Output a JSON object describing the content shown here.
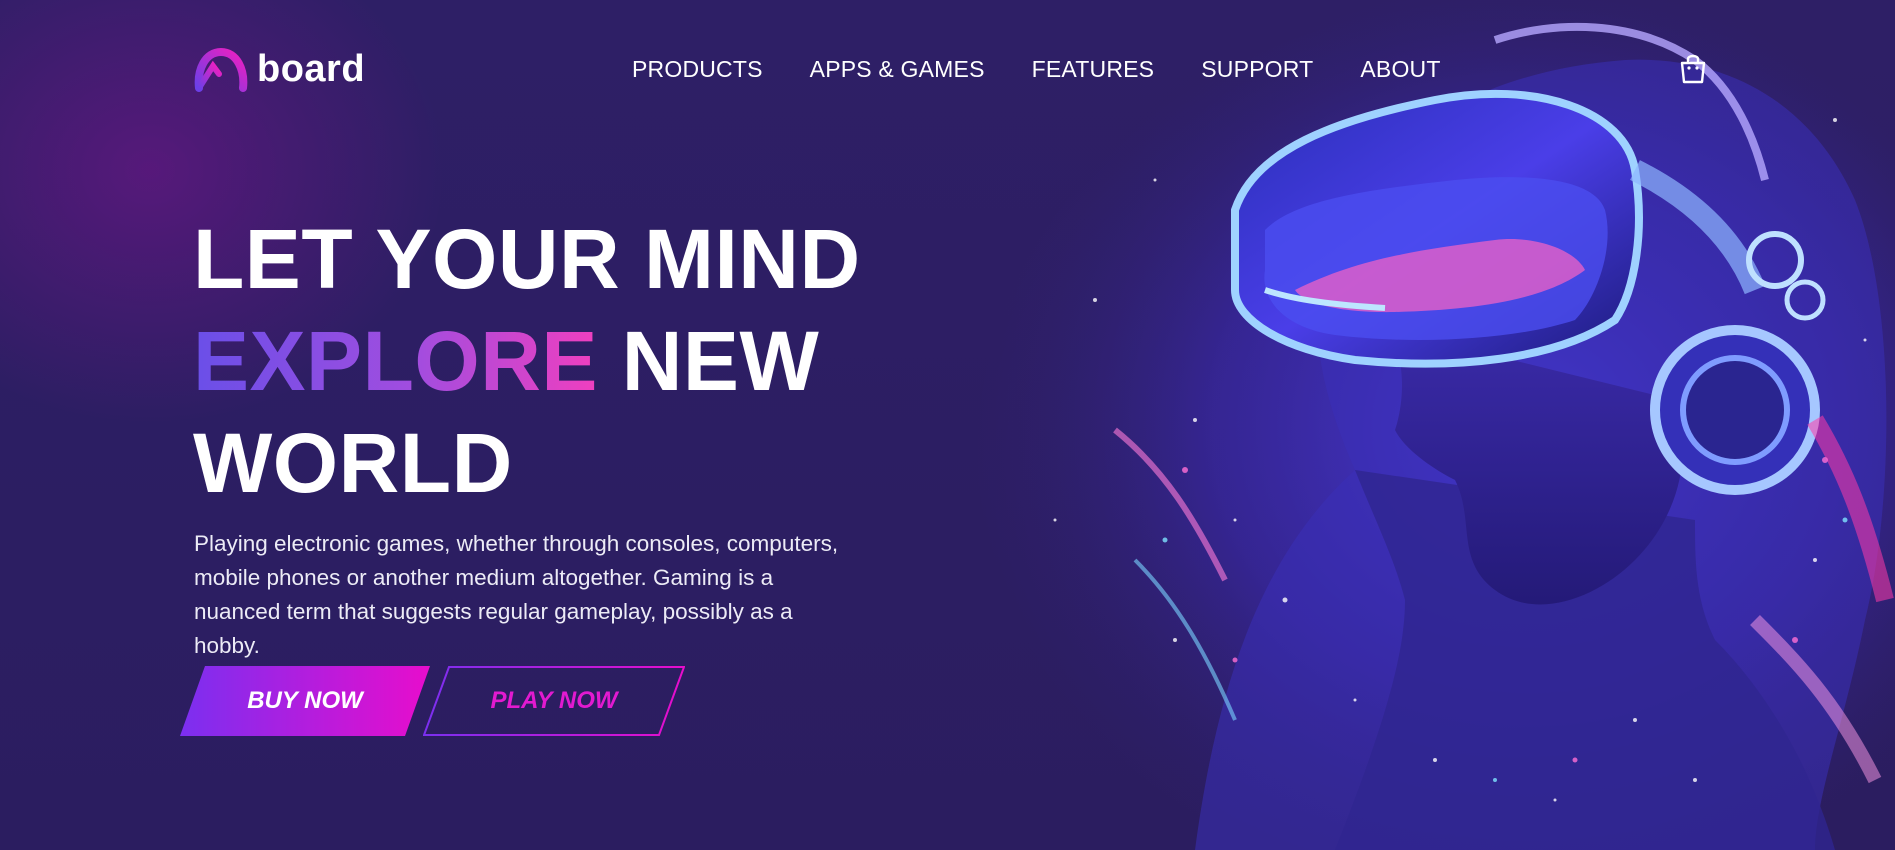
{
  "brand": {
    "name": "board",
    "logo_icon": "arch-logo-icon"
  },
  "nav": {
    "items": [
      {
        "label": "PRODUCTS"
      },
      {
        "label": "APPS & GAMES"
      },
      {
        "label": "FEATURES"
      },
      {
        "label": "SUPPORT"
      },
      {
        "label": "ABOUT"
      }
    ],
    "cart_icon": "shopping-bag-icon"
  },
  "hero": {
    "line1": "LET YOUR MIND",
    "line2_highlight": "EXPLORE",
    "line2_rest": " NEW",
    "line3": "WORLD",
    "description": "Playing electronic games, whether through consoles, computers, mobile phones or another medium altogether. Gaming is a nuanced term that suggests regular gameplay, possibly as a hobby.",
    "buy_label": "BUY NOW",
    "play_label": "PLAY NOW"
  },
  "colors": {
    "background": "#2c1f63",
    "gradient_start": "#7b2ff0",
    "gradient_end": "#e80dcc",
    "accent_pink": "#e21ad0"
  }
}
